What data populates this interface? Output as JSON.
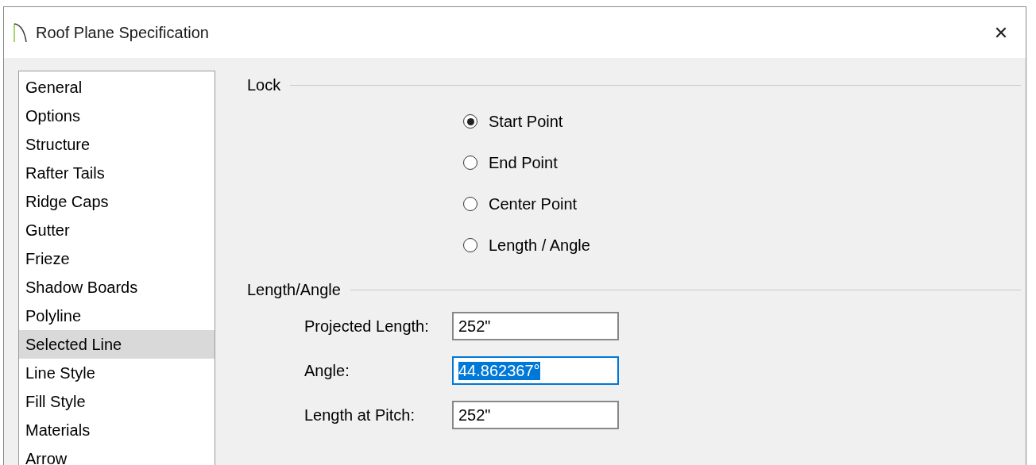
{
  "window": {
    "title": "Roof Plane Specification",
    "close": "✕"
  },
  "sidebar": {
    "items": [
      {
        "label": "General",
        "selected": false
      },
      {
        "label": "Options",
        "selected": false
      },
      {
        "label": "Structure",
        "selected": false
      },
      {
        "label": "Rafter Tails",
        "selected": false
      },
      {
        "label": "Ridge Caps",
        "selected": false
      },
      {
        "label": "Gutter",
        "selected": false
      },
      {
        "label": "Frieze",
        "selected": false
      },
      {
        "label": "Shadow Boards",
        "selected": false
      },
      {
        "label": "Polyline",
        "selected": false
      },
      {
        "label": "Selected Line",
        "selected": true
      },
      {
        "label": "Line Style",
        "selected": false
      },
      {
        "label": "Fill Style",
        "selected": false
      },
      {
        "label": "Materials",
        "selected": false
      },
      {
        "label": "Arrow",
        "selected": false
      }
    ]
  },
  "lock": {
    "title": "Lock",
    "options": [
      {
        "label": "Start Point",
        "selected": true
      },
      {
        "label": "End Point",
        "selected": false
      },
      {
        "label": "Center Point",
        "selected": false
      },
      {
        "label": "Length / Angle",
        "selected": false
      }
    ]
  },
  "length_angle": {
    "title": "Length/Angle",
    "fields": [
      {
        "label": "Projected Length:",
        "value": "252\"",
        "focused": false
      },
      {
        "label": "Angle:",
        "value": "44.862367°",
        "focused": true
      },
      {
        "label": "Length at Pitch:",
        "value": "252\"",
        "focused": false
      }
    ]
  }
}
